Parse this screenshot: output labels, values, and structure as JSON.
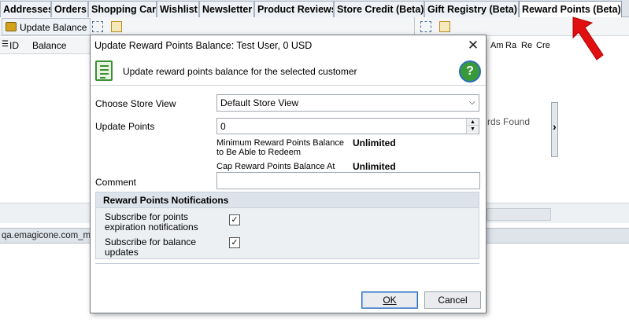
{
  "tabs": [
    {
      "label": "Addresses"
    },
    {
      "label": "Orders"
    },
    {
      "label": "Shopping Cart"
    },
    {
      "label": "Wishlist"
    },
    {
      "label": "Newsletter"
    },
    {
      "label": "Product Reviews"
    },
    {
      "label": "Store Credit (Beta)"
    },
    {
      "label": "Gift Registry (Beta)"
    },
    {
      "label": "Reward Points (Beta)",
      "active": true
    }
  ],
  "background": {
    "update_balance_label": "Update Balance",
    "grid_columns": [
      "ID",
      "Balance"
    ],
    "right_columns": [
      "Am",
      "Ra",
      "Re",
      "Cre"
    ],
    "right_empty_text": "rds Found",
    "status_text": "qa.emagicone.com_mag"
  },
  "dialog": {
    "title": "Update Reward Points Balance: Test User, 0 USD",
    "header_text": "Update reward points balance for the selected customer",
    "store_view_label": "Choose Store View",
    "store_view_value": "Default Store View",
    "update_points_label": "Update Points",
    "update_points_value": "0",
    "min_balance_label": "Minimum Reward Points Balance to Be Able to Redeem",
    "min_balance_value": "Unlimited",
    "cap_balance_label": "Cap Reward Points Balance At",
    "cap_balance_value": "Unlimited",
    "comment_label": "Comment",
    "comment_value": "",
    "notifications": {
      "title": "Reward Points Notifications",
      "expiration_label": "Subscribe for points expiration notifications",
      "expiration_checked": true,
      "balance_label": "Subscribe for balance updates",
      "balance_checked": true
    },
    "ok_label": "OK",
    "cancel_label": "Cancel"
  },
  "colors": {
    "arrow": "#e01010",
    "tab_strip": "#dfe4ea",
    "group_bg": "#edf0f3"
  }
}
